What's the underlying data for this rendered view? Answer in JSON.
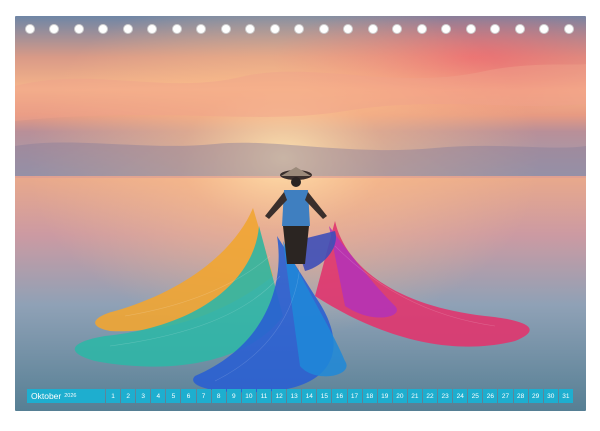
{
  "calendar": {
    "month": "Oktober",
    "year": "2026",
    "days": [
      "1",
      "2",
      "3",
      "4",
      "5",
      "6",
      "7",
      "8",
      "9",
      "10",
      "11",
      "12",
      "13",
      "14",
      "15",
      "16",
      "17",
      "18",
      "19",
      "20",
      "21",
      "22",
      "23",
      "24",
      "25",
      "26",
      "27",
      "28",
      "29",
      "30",
      "31"
    ],
    "accent_color": "#1eaecf"
  },
  "photo": {
    "subject": "fisherman-with-rainbow-net-icon"
  }
}
